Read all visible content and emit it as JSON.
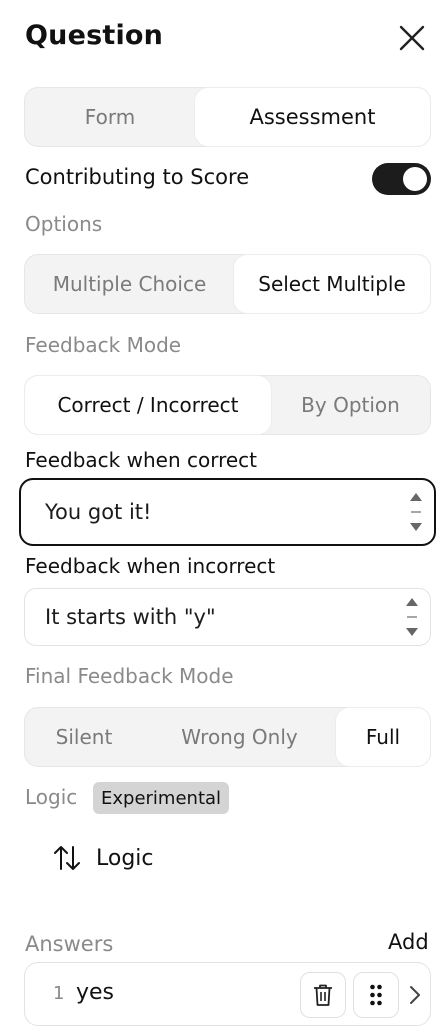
{
  "header": {
    "title": "Question",
    "close_icon": "close-icon"
  },
  "mode_tabs": [
    {
      "label": "Form",
      "active": false
    },
    {
      "label": "Assessment",
      "active": true
    }
  ],
  "contributing": {
    "label": "Contributing to Score",
    "enabled": true
  },
  "options": {
    "heading": "Options",
    "tabs": [
      {
        "label": "Multiple Choice",
        "active": false
      },
      {
        "label": "Select Multiple",
        "active": true
      }
    ]
  },
  "feedback_mode": {
    "heading": "Feedback Mode",
    "tabs": [
      {
        "label": "Correct / Incorrect",
        "active": true
      },
      {
        "label": "By Option",
        "active": false
      }
    ]
  },
  "feedback_correct": {
    "label": "Feedback when correct",
    "value": "You got it!"
  },
  "feedback_incorrect": {
    "label": "Feedback when incorrect",
    "value": "It starts with \"y\""
  },
  "final_feedback_mode": {
    "heading": "Final Feedback Mode",
    "tabs": [
      {
        "label": "Silent",
        "active": false
      },
      {
        "label": "Wrong Only",
        "active": false
      },
      {
        "label": "Full",
        "active": true
      }
    ]
  },
  "logic": {
    "heading": "Logic",
    "badge": "Experimental",
    "button_label": "Logic",
    "icon": "sort-arrows-icon"
  },
  "answers": {
    "heading": "Answers",
    "add_label": "Add",
    "items": [
      {
        "index": "1",
        "text": "yes"
      }
    ]
  },
  "colors": {
    "toggle_on": "#1c1c1c",
    "badge_bg": "#d4d4d4",
    "focus_border": "#111111"
  }
}
